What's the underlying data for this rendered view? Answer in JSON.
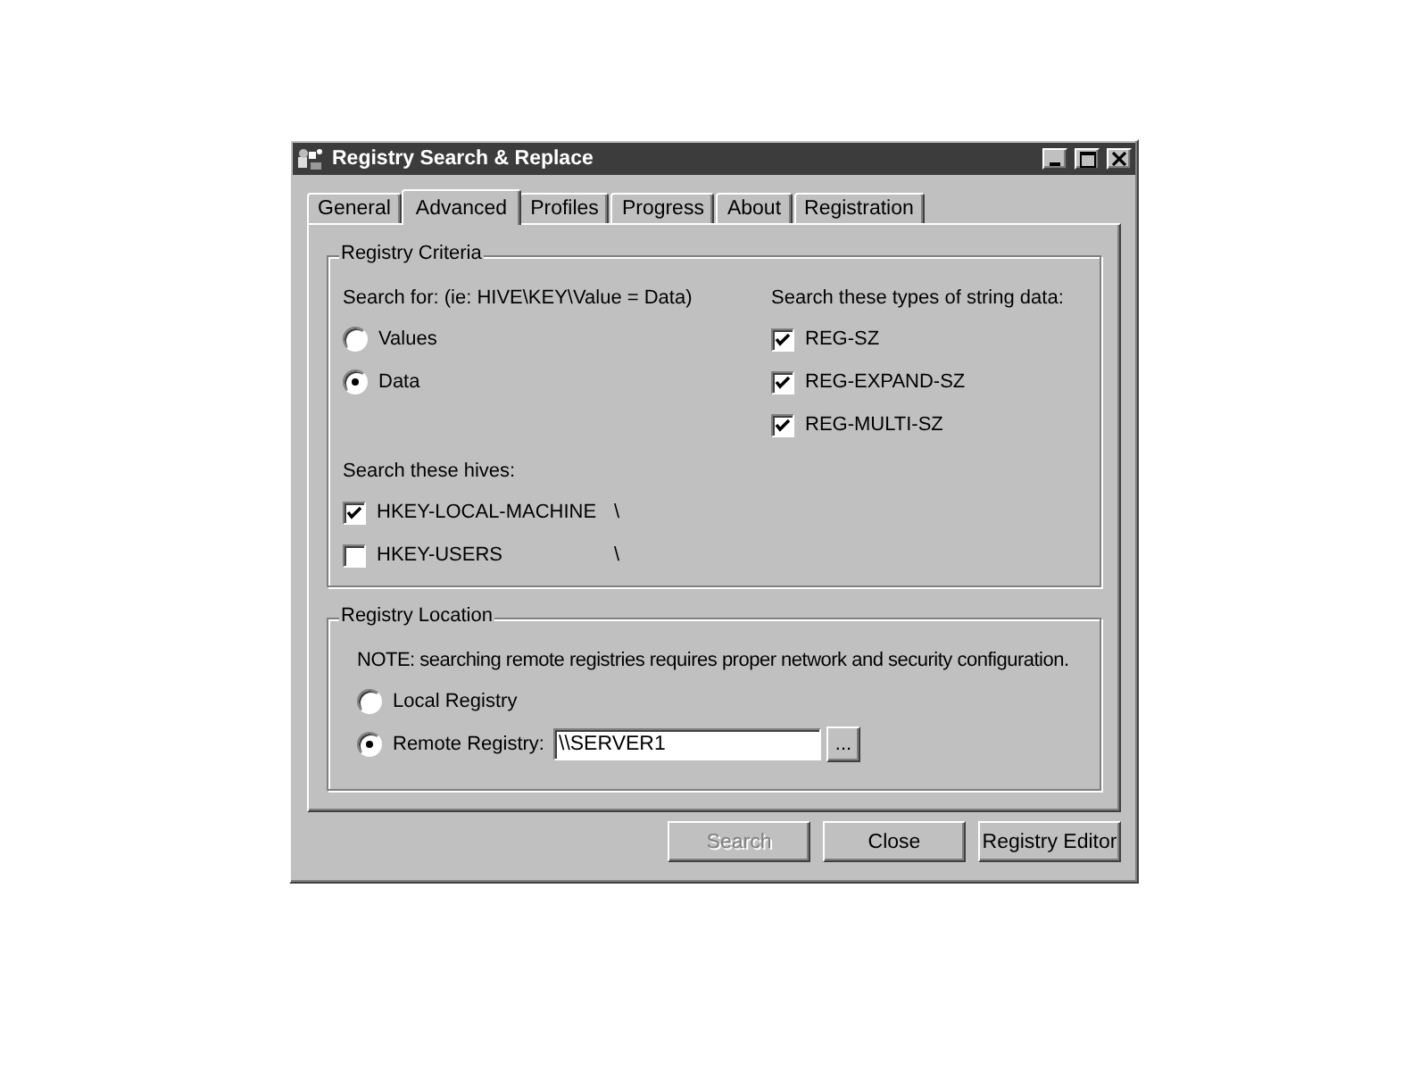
{
  "window": {
    "title": "Registry Search & Replace"
  },
  "tabs": [
    {
      "label": "General",
      "selected": false
    },
    {
      "label": "Advanced",
      "selected": true
    },
    {
      "label": "Profiles",
      "selected": false
    },
    {
      "label": "Progress",
      "selected": false
    },
    {
      "label": "About",
      "selected": false
    },
    {
      "label": "Registration",
      "selected": false
    }
  ],
  "registry_criteria": {
    "title": "Registry Criteria",
    "search_for": {
      "label": "Search for: (ie: HIVE\\KEY\\Value = Data)",
      "options": [
        {
          "label": "Values",
          "selected": false
        },
        {
          "label": "Data",
          "selected": true
        }
      ]
    },
    "string_types": {
      "label": "Search these types of string data:",
      "items": [
        {
          "label": "REG-SZ",
          "checked": true
        },
        {
          "label": "REG-EXPAND-SZ",
          "checked": true
        },
        {
          "label": "REG-MULTI-SZ",
          "checked": true
        }
      ]
    },
    "hives": {
      "label": "Search these hives:",
      "items": [
        {
          "label": "HKEY-LOCAL-MACHINE",
          "checked": true,
          "suffix": "\\"
        },
        {
          "label": "HKEY-USERS",
          "checked": false,
          "suffix": "\\"
        }
      ]
    }
  },
  "registry_location": {
    "title": "Registry Location",
    "note": "NOTE: searching remote registries requires proper network and security configuration.",
    "options": [
      {
        "label": "Local Registry",
        "selected": false
      },
      {
        "label": "Remote Registry:",
        "selected": true,
        "field": {
          "value": "\\\\SERVER1"
        },
        "browse": "..."
      }
    ]
  },
  "buttons": [
    {
      "label": "Search",
      "disabled": true
    },
    {
      "label": "Close",
      "disabled": false
    },
    {
      "label": "Registry Editor",
      "disabled": false
    }
  ]
}
